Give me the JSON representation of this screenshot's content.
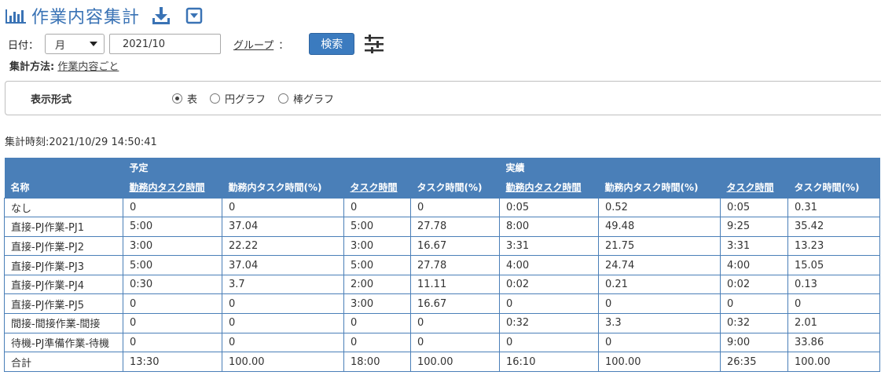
{
  "header": {
    "title": "作業内容集計"
  },
  "filter": {
    "date_label": "日付：",
    "period_value": "月",
    "date_value": "2021/10",
    "group_label": "グループ",
    "group_colon": "：",
    "search_label": "検索"
  },
  "method": {
    "label": "集計方法:",
    "value": "作業内容ごと"
  },
  "display": {
    "label": "表示形式",
    "options": [
      "表",
      "円グラフ",
      "棒グラフ"
    ],
    "selected": "表"
  },
  "timestamp": "集計時刻:2021/10/29 14:50:41",
  "table": {
    "group_headers": {
      "plan": "予定",
      "actual": "実績"
    },
    "columns": [
      "名称",
      "勤務内タスク時間",
      "勤務内タスク時間(%)",
      "タスク時間",
      "タスク時間(%)",
      "勤務内タスク時間",
      "勤務内タスク時間(%)",
      "タスク時間",
      "タスク時間(%)"
    ],
    "rows": [
      [
        "なし",
        "0",
        "0",
        "0",
        "0",
        "0:05",
        "0.52",
        "0:05",
        "0.31"
      ],
      [
        "直接-PJ作業-PJ1",
        "5:00",
        "37.04",
        "5:00",
        "27.78",
        "8:00",
        "49.48",
        "9:25",
        "35.42"
      ],
      [
        "直接-PJ作業-PJ2",
        "3:00",
        "22.22",
        "3:00",
        "16.67",
        "3:31",
        "21.75",
        "3:31",
        "13.23"
      ],
      [
        "直接-PJ作業-PJ3",
        "5:00",
        "37.04",
        "5:00",
        "27.78",
        "4:00",
        "24.74",
        "4:00",
        "15.05"
      ],
      [
        "直接-PJ作業-PJ4",
        "0:30",
        "3.7",
        "2:00",
        "11.11",
        "0:02",
        "0.21",
        "0:02",
        "0.13"
      ],
      [
        "直接-PJ作業-PJ5",
        "0",
        "0",
        "3:00",
        "16.67",
        "0",
        "0",
        "0",
        "0"
      ],
      [
        "間接-間接作業-間接",
        "0",
        "0",
        "0",
        "0",
        "0:32",
        "3.3",
        "0:32",
        "2.01"
      ],
      [
        "待機-PJ準備作業-待機",
        "0",
        "0",
        "0",
        "0",
        "0",
        "0",
        "9:00",
        "33.86"
      ],
      [
        "合計",
        "13:30",
        "100.00",
        "18:00",
        "100.00",
        "16:10",
        "100.00",
        "26:35",
        "100.00"
      ]
    ]
  },
  "colors": {
    "accent": "#3a73b5",
    "header_bg": "#4a7fb8",
    "button": "#3b7bbf"
  },
  "icons": [
    "bar-chart-icon",
    "download-icon",
    "dropdown-icon",
    "chevron-down-icon",
    "settings-sliders-icon",
    "radio-icon"
  ]
}
